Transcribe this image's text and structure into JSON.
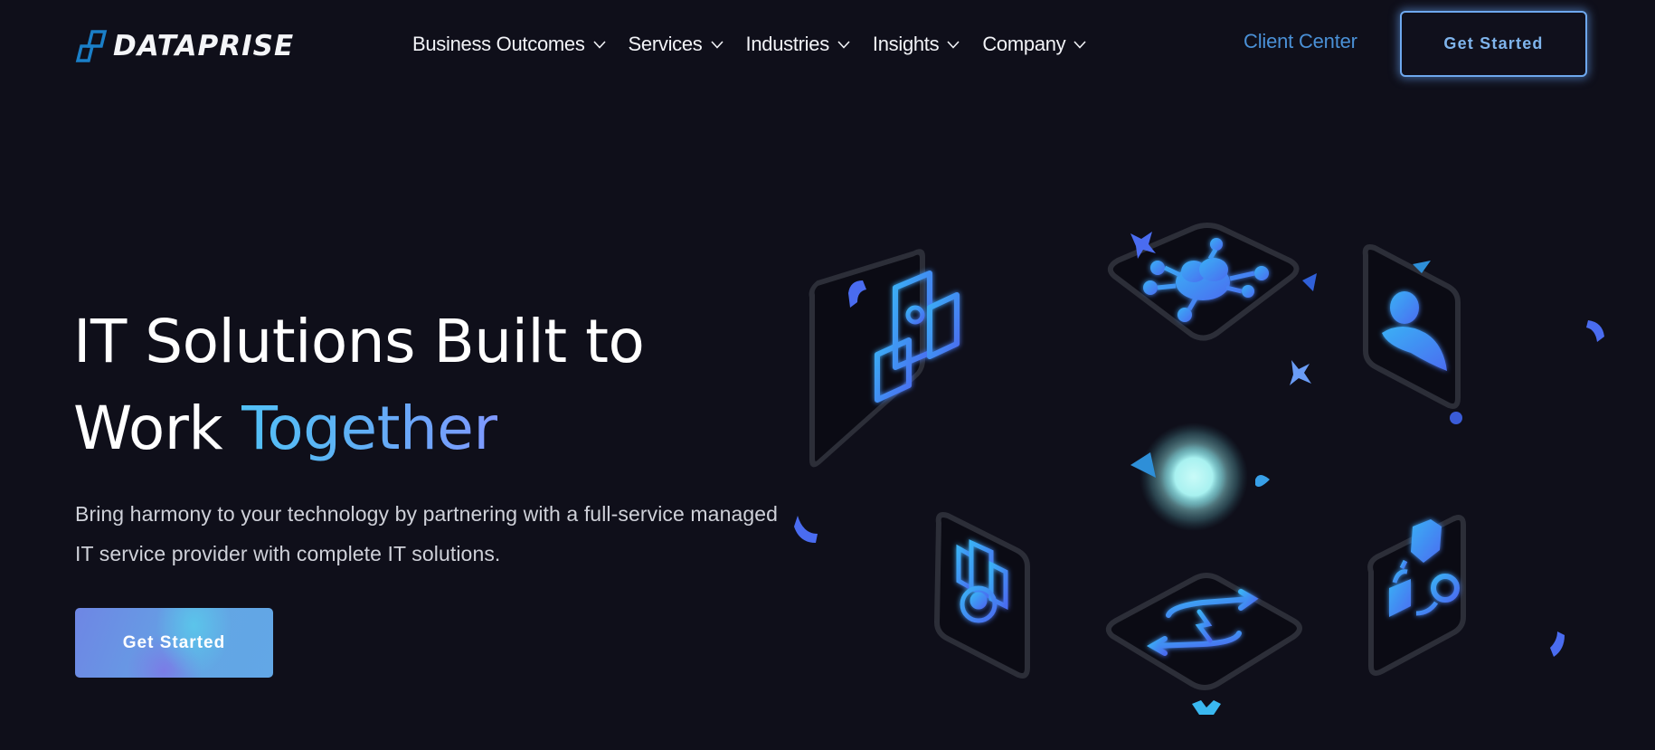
{
  "brand": {
    "name": "DATAPRISE",
    "logo_icon": "dataprise-logo-icon",
    "logo_color": "#1a7fc8"
  },
  "nav": {
    "items": [
      {
        "label": "Business Outcomes",
        "icon": "chevron-down-icon"
      },
      {
        "label": "Services",
        "icon": "chevron-down-icon"
      },
      {
        "label": "Industries",
        "icon": "chevron-down-icon"
      },
      {
        "label": "Insights",
        "icon": "chevron-down-icon"
      },
      {
        "label": "Company",
        "icon": "chevron-down-icon"
      }
    ],
    "client_center": "Client Center",
    "get_started": "Get Started"
  },
  "hero": {
    "title_line1": "IT Solutions Built to",
    "title_line2_plain": "Work ",
    "title_line2_accent": "Together",
    "subtitle": "Bring harmony to your technology by partnering with a full-service managed IT service provider with complete IT solutions.",
    "cta": "Get Started"
  },
  "illustration": {
    "tiles": [
      {
        "icon": "devices-settings-icon"
      },
      {
        "icon": "cloud-network-icon"
      },
      {
        "icon": "user-profile-icon"
      },
      {
        "icon": "server-user-icon"
      },
      {
        "icon": "sync-lightning-icon"
      },
      {
        "icon": "security-lock-icon"
      }
    ],
    "center": "glowing-orb"
  },
  "colors": {
    "background": "#0f0f1a",
    "accent_blue": "#4a90d6",
    "icon_blue": "#3f7ff0",
    "icon_cyan": "#38b6f0",
    "orb": "#a8f1f0"
  }
}
